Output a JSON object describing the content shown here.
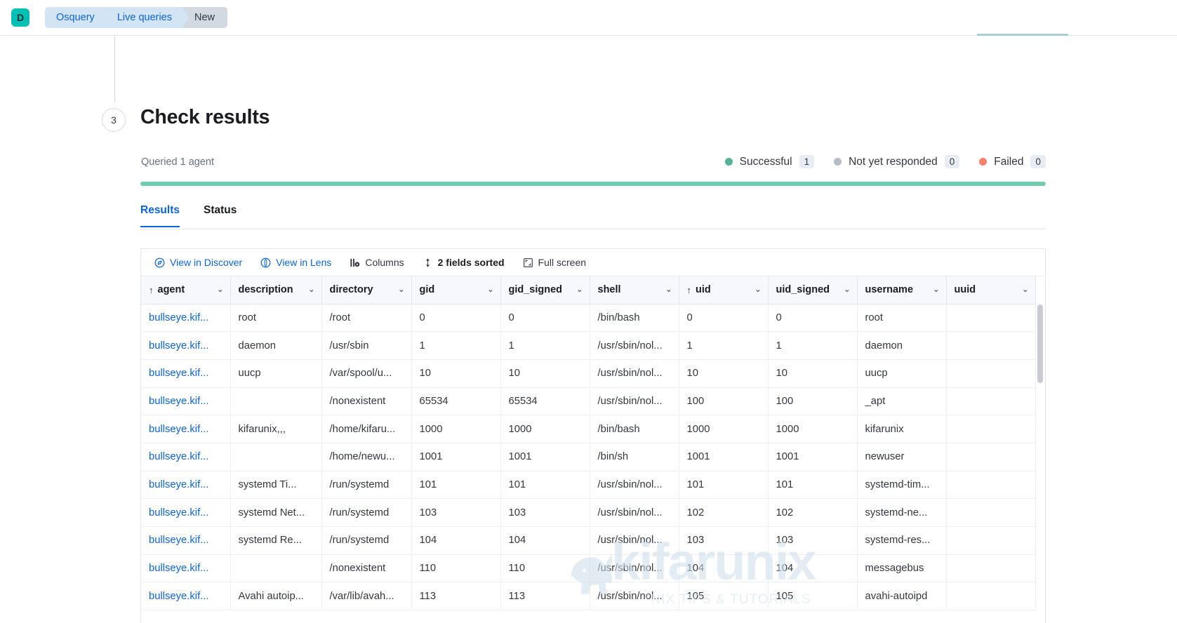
{
  "topbar": {
    "space_avatar": "D",
    "breadcrumbs": [
      {
        "label": "Osquery",
        "type": "link"
      },
      {
        "label": "Live queries",
        "type": "link"
      },
      {
        "label": "New",
        "type": "current"
      }
    ]
  },
  "step": {
    "number": "3",
    "title": "Check results",
    "queried_text": "Queried 1 agent"
  },
  "status_legend": [
    {
      "label": "Successful",
      "count": "1",
      "color": "#54b399"
    },
    {
      "label": "Not yet responded",
      "count": "0",
      "color": "#b6bcc6"
    },
    {
      "label": "Failed",
      "count": "0",
      "color": "#fc7e6c"
    }
  ],
  "progress": {
    "percent": 100,
    "color": "#6dccb1"
  },
  "tabs": [
    {
      "label": "Results",
      "active": true
    },
    {
      "label": "Status",
      "active": false
    }
  ],
  "grid_toolbar": [
    {
      "label": "View in Discover",
      "icon": "discover-icon",
      "style": "link"
    },
    {
      "label": "View in Lens",
      "icon": "lens-icon",
      "style": "link"
    },
    {
      "label": "Columns",
      "icon": "columns-icon",
      "style": "dark"
    },
    {
      "label": "2 fields sorted",
      "icon": "sort-icon",
      "style": "bold"
    },
    {
      "label": "Full screen",
      "icon": "fullscreen-icon",
      "style": "dark"
    }
  ],
  "table": {
    "columns": [
      {
        "key": "agent",
        "label": "agent",
        "sorted": true,
        "sort_dir": "asc"
      },
      {
        "key": "description",
        "label": "description",
        "sorted": false
      },
      {
        "key": "directory",
        "label": "directory",
        "sorted": false
      },
      {
        "key": "gid",
        "label": "gid",
        "sorted": false
      },
      {
        "key": "gid_signed",
        "label": "gid_signed",
        "sorted": false
      },
      {
        "key": "shell",
        "label": "shell",
        "sorted": false
      },
      {
        "key": "uid",
        "label": "uid",
        "sorted": true,
        "sort_dir": "asc"
      },
      {
        "key": "uid_signed",
        "label": "uid_signed",
        "sorted": false
      },
      {
        "key": "username",
        "label": "username",
        "sorted": false
      },
      {
        "key": "uuid",
        "label": "uuid",
        "sorted": false
      }
    ],
    "rows": [
      {
        "agent": "bullseye.kif...",
        "description": "root",
        "directory": "/root",
        "gid": "0",
        "gid_signed": "0",
        "shell": "/bin/bash",
        "uid": "0",
        "uid_signed": "0",
        "username": "root",
        "uuid": ""
      },
      {
        "agent": "bullseye.kif...",
        "description": "daemon",
        "directory": "/usr/sbin",
        "gid": "1",
        "gid_signed": "1",
        "shell": "/usr/sbin/nol...",
        "uid": "1",
        "uid_signed": "1",
        "username": "daemon",
        "uuid": ""
      },
      {
        "agent": "bullseye.kif...",
        "description": "uucp",
        "directory": "/var/spool/u...",
        "gid": "10",
        "gid_signed": "10",
        "shell": "/usr/sbin/nol...",
        "uid": "10",
        "uid_signed": "10",
        "username": "uucp",
        "uuid": ""
      },
      {
        "agent": "bullseye.kif...",
        "description": "",
        "directory": "/nonexistent",
        "gid": "65534",
        "gid_signed": "65534",
        "shell": "/usr/sbin/nol...",
        "uid": "100",
        "uid_signed": "100",
        "username": "_apt",
        "uuid": ""
      },
      {
        "agent": "bullseye.kif...",
        "description": "kifarunix,,,",
        "directory": "/home/kifaru...",
        "gid": "1000",
        "gid_signed": "1000",
        "shell": "/bin/bash",
        "uid": "1000",
        "uid_signed": "1000",
        "username": "kifarunix",
        "uuid": ""
      },
      {
        "agent": "bullseye.kif...",
        "description": "",
        "directory": "/home/newu...",
        "gid": "1001",
        "gid_signed": "1001",
        "shell": "/bin/sh",
        "uid": "1001",
        "uid_signed": "1001",
        "username": "newuser",
        "uuid": ""
      },
      {
        "agent": "bullseye.kif...",
        "description": "systemd Ti...",
        "directory": "/run/systemd",
        "gid": "101",
        "gid_signed": "101",
        "shell": "/usr/sbin/nol...",
        "uid": "101",
        "uid_signed": "101",
        "username": "systemd-tim...",
        "uuid": ""
      },
      {
        "agent": "bullseye.kif...",
        "description": "systemd Net...",
        "directory": "/run/systemd",
        "gid": "103",
        "gid_signed": "103",
        "shell": "/usr/sbin/nol...",
        "uid": "102",
        "uid_signed": "102",
        "username": "systemd-ne...",
        "uuid": ""
      },
      {
        "agent": "bullseye.kif...",
        "description": "systemd Re...",
        "directory": "/run/systemd",
        "gid": "104",
        "gid_signed": "104",
        "shell": "/usr/sbin/nol...",
        "uid": "103",
        "uid_signed": "103",
        "username": "systemd-res...",
        "uuid": ""
      },
      {
        "agent": "bullseye.kif...",
        "description": "",
        "directory": "/nonexistent",
        "gid": "110",
        "gid_signed": "110",
        "shell": "/usr/sbin/nol...",
        "uid": "104",
        "uid_signed": "104",
        "username": "messagebus",
        "uuid": ""
      },
      {
        "agent": "bullseye.kif...",
        "description": "Avahi autoip...",
        "directory": "/var/lib/avah...",
        "gid": "113",
        "gid_signed": "113",
        "shell": "/usr/sbin/nol...",
        "uid": "105",
        "uid_signed": "105",
        "username": "avahi-autoipd",
        "uuid": ""
      }
    ]
  },
  "watermark": {
    "text": "kifarunix",
    "subtext": "*NIX TIPS & TUTORIALS"
  }
}
